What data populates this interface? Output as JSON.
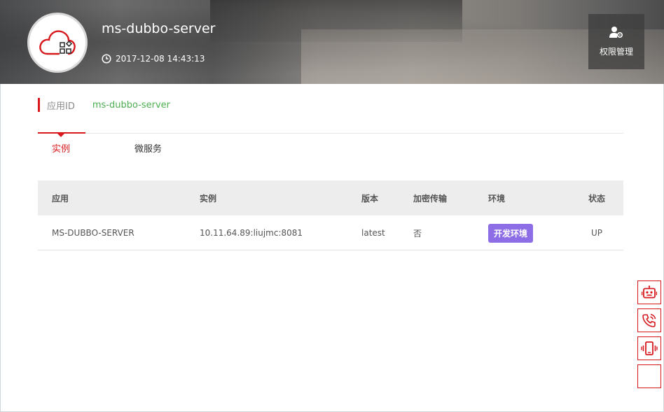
{
  "header": {
    "app_name": "ms-dubbo-server",
    "created_time": "2017-12-08 14:43:13",
    "permission_label": "权限管理"
  },
  "app_id": {
    "label": "应用ID",
    "value": "ms-dubbo-server"
  },
  "tabs": [
    {
      "label": "实例",
      "active": true
    },
    {
      "label": "微服务",
      "active": false
    }
  ],
  "table": {
    "columns": [
      "应用",
      "实例",
      "版本",
      "加密传输",
      "环境",
      "状态"
    ],
    "rows": [
      {
        "app": "MS-DUBBO-SERVER",
        "instance": "10.11.64.89:liujmc:8081",
        "version": "latest",
        "encrypted": "否",
        "env": "开发环境",
        "status": "UP"
      }
    ]
  },
  "side_buttons": [
    "robot-icon",
    "phone-icon",
    "mobile-icon",
    "blank"
  ],
  "colors": {
    "accent": "#d7191e",
    "app_id_value": "#4caf50",
    "env_badge": "#8d6ee6"
  }
}
